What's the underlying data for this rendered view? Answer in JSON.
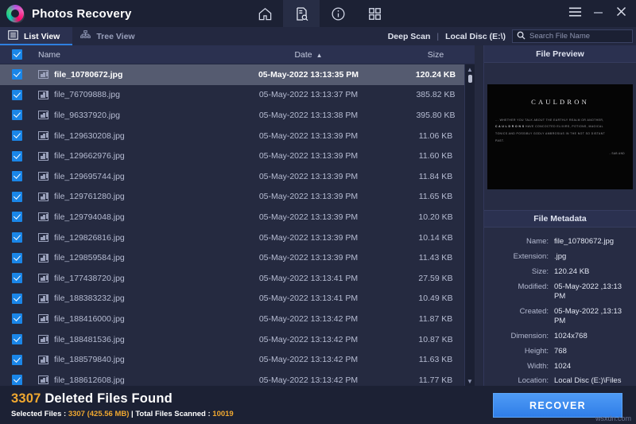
{
  "titlebar": {
    "app_title": "Photos Recovery",
    "logo_icon": "photos-recovery-logo",
    "nav": [
      {
        "icon": "home-icon",
        "name": "home",
        "active": false
      },
      {
        "icon": "scan-document-icon",
        "name": "scan",
        "active": true
      },
      {
        "icon": "info-icon",
        "name": "info",
        "active": false
      },
      {
        "icon": "grid-icon",
        "name": "grid",
        "active": false
      }
    ],
    "window_controls": [
      {
        "icon": "hamburger-menu-icon",
        "name": "menu"
      },
      {
        "icon": "minimize-icon",
        "name": "minimize"
      },
      {
        "icon": "close-icon",
        "name": "close"
      }
    ]
  },
  "subbar": {
    "tabs": [
      {
        "label": "List View",
        "icon": "list-view-icon",
        "active": true
      },
      {
        "label": "Tree View",
        "icon": "tree-view-icon",
        "active": false
      }
    ],
    "scan_mode": "Deep Scan",
    "separator": "|",
    "disc": "Local Disc (E:\\)",
    "search": {
      "icon": "search-icon",
      "placeholder": "Search File Name",
      "value": "",
      "clear_icon": "close-icon"
    }
  },
  "table": {
    "select_all_checked": true,
    "columns": {
      "name": "Name",
      "date": "Date",
      "size": "Size"
    },
    "sort_column": "Date",
    "sort_direction": "ascending",
    "sort_arrow": "▲",
    "rows": [
      {
        "checked": true,
        "name": "file_10780672.jpg",
        "date": "05-May-2022 13:13:35 PM",
        "size": "120.24 KB",
        "selected": true
      },
      {
        "checked": true,
        "name": "file_76709888.jpg",
        "date": "05-May-2022 13:13:37 PM",
        "size": "385.82 KB",
        "selected": false
      },
      {
        "checked": true,
        "name": "file_96337920.jpg",
        "date": "05-May-2022 13:13:38 PM",
        "size": "395.80 KB",
        "selected": false
      },
      {
        "checked": true,
        "name": "file_129630208.jpg",
        "date": "05-May-2022 13:13:39 PM",
        "size": "11.06 KB",
        "selected": false
      },
      {
        "checked": true,
        "name": "file_129662976.jpg",
        "date": "05-May-2022 13:13:39 PM",
        "size": "11.60 KB",
        "selected": false
      },
      {
        "checked": true,
        "name": "file_129695744.jpg",
        "date": "05-May-2022 13:13:39 PM",
        "size": "11.84 KB",
        "selected": false
      },
      {
        "checked": true,
        "name": "file_129761280.jpg",
        "date": "05-May-2022 13:13:39 PM",
        "size": "11.65 KB",
        "selected": false
      },
      {
        "checked": true,
        "name": "file_129794048.jpg",
        "date": "05-May-2022 13:13:39 PM",
        "size": "10.20 KB",
        "selected": false
      },
      {
        "checked": true,
        "name": "file_129826816.jpg",
        "date": "05-May-2022 13:13:39 PM",
        "size": "10.14 KB",
        "selected": false
      },
      {
        "checked": true,
        "name": "file_129859584.jpg",
        "date": "05-May-2022 13:13:39 PM",
        "size": "11.43 KB",
        "selected": false
      },
      {
        "checked": true,
        "name": "file_177438720.jpg",
        "date": "05-May-2022 13:13:41 PM",
        "size": "27.59 KB",
        "selected": false
      },
      {
        "checked": true,
        "name": "file_188383232.jpg",
        "date": "05-May-2022 13:13:41 PM",
        "size": "10.49 KB",
        "selected": false
      },
      {
        "checked": true,
        "name": "file_188416000.jpg",
        "date": "05-May-2022 13:13:42 PM",
        "size": "11.87 KB",
        "selected": false
      },
      {
        "checked": true,
        "name": "file_188481536.jpg",
        "date": "05-May-2022 13:13:42 PM",
        "size": "10.87 KB",
        "selected": false
      },
      {
        "checked": true,
        "name": "file_188579840.jpg",
        "date": "05-May-2022 13:13:42 PM",
        "size": "11.63 KB",
        "selected": false
      },
      {
        "checked": true,
        "name": "file_188612608.jpg",
        "date": "05-May-2022 13:13:42 PM",
        "size": "11.77 KB",
        "selected": false
      }
    ]
  },
  "preview": {
    "title": "File Preview",
    "image": {
      "heading": "CAULDRON",
      "body_line1": "... WHETHER YOU TALK ABOUT THE EARTHLY REALM OR ANOTHER,",
      "body_emphasis": "C A U L D R O N S",
      "body_line2": "HAVE CONCOCTED ELIXIRS, POTIONS, MAGICAL",
      "body_line3": "TONICS AND POSSIBLY GODLY AMBROSIAS IN THE NOT SO DISTANT",
      "body_line4": "PAST.",
      "signature": "- SAB AND"
    }
  },
  "metadata": {
    "title": "File Metadata",
    "fields": [
      {
        "key": "Name:",
        "value": "file_10780672.jpg"
      },
      {
        "key": "Extension:",
        "value": ".jpg"
      },
      {
        "key": "Size:",
        "value": "120.24 KB"
      },
      {
        "key": "Modified:",
        "value": "05-May-2022 ,13:13 PM"
      },
      {
        "key": "Created:",
        "value": "05-May-2022 ,13:13 PM"
      },
      {
        "key": "Dimension:",
        "value": "1024x768"
      },
      {
        "key": "Height:",
        "value": "768"
      },
      {
        "key": "Width:",
        "value": "1024"
      },
      {
        "key": "Location:",
        "value": "Local Disc (E:)\\Files by content\\.jpg"
      }
    ]
  },
  "footer": {
    "found_count": "3307",
    "found_label": "Deleted Files Found",
    "selected_label": "Selected Files : ",
    "selected_count": "3307 (425.56 MB)",
    "divider": " | ",
    "scanned_label": "Total Files Scanned : ",
    "scanned_count": "10019",
    "recover_label": "RECOVER",
    "watermark": "wsxdn.com"
  },
  "colors": {
    "accent_blue": "#2f7de8",
    "amber": "#f0a830",
    "window_bg": "#252a40",
    "titlebar_bg": "#1c2134",
    "row_selected": "#555b70",
    "checkbox_blue": "#1a86e8"
  }
}
